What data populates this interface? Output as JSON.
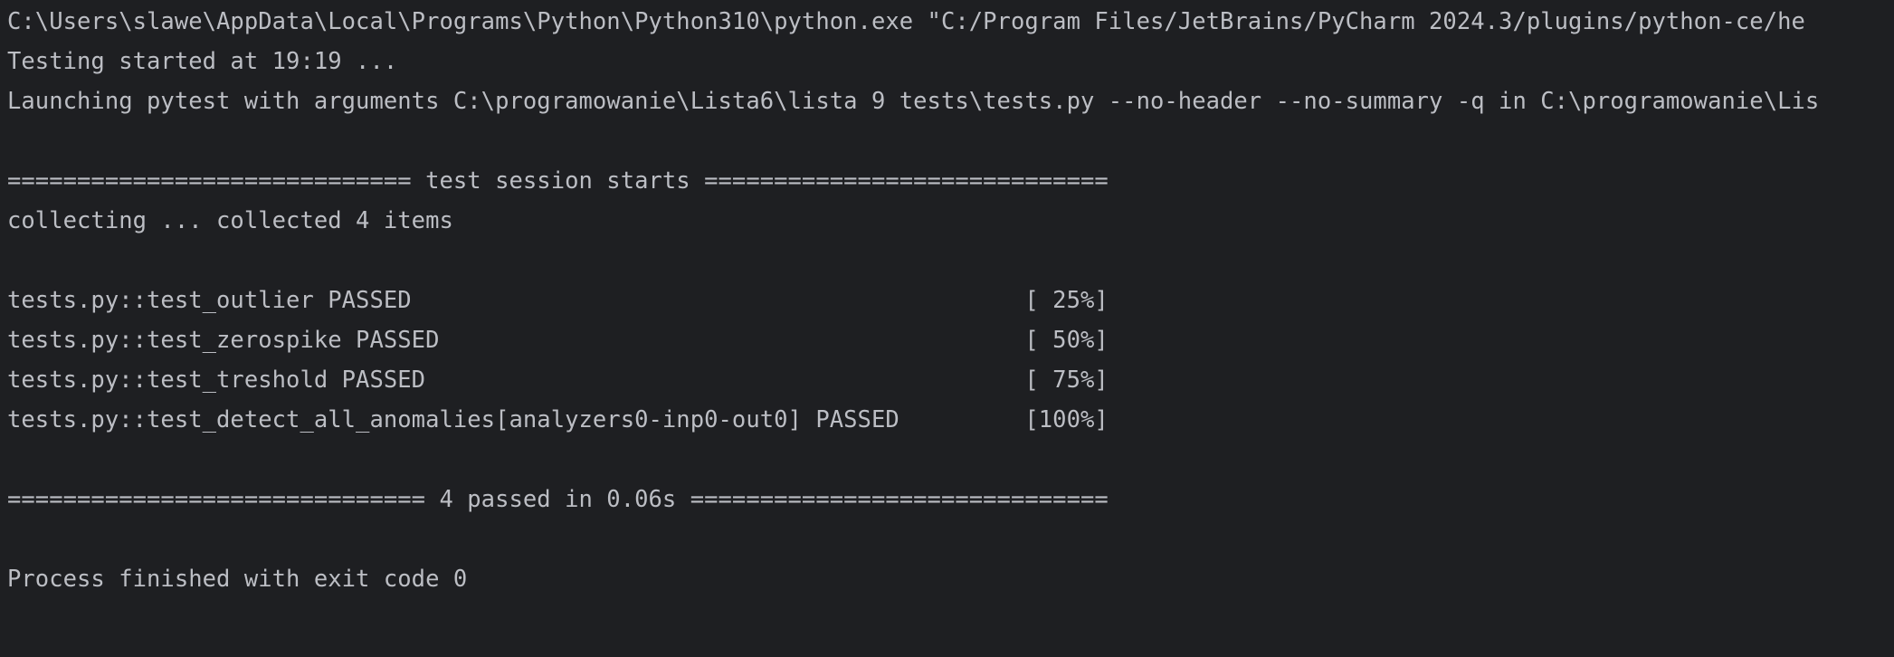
{
  "colors": {
    "background": "#1e1f22",
    "text": "#bcbec4"
  },
  "console": {
    "lines": [
      "C:\\Users\\slawe\\AppData\\Local\\Programs\\Python\\Python310\\python.exe \"C:/Program Files/JetBrains/PyCharm 2024.3/plugins/python-ce/he",
      "Testing started at 19:19 ...",
      "Launching pytest with arguments C:\\programowanie\\Lista6\\lista 9 tests\\tests.py --no-header --no-summary -q in C:\\programowanie\\Lis",
      "",
      "============================= test session starts =============================",
      "collecting ... collected 4 items",
      "",
      "tests.py::test_outlier PASSED                                            [ 25%]",
      "tests.py::test_zerospike PASSED                                          [ 50%]",
      "tests.py::test_treshold PASSED                                           [ 75%]",
      "tests.py::test_detect_all_anomalies[analyzers0-inp0-out0] PASSED         [100%]",
      "",
      "============================== 4 passed in 0.06s ==============================",
      "",
      "Process finished with exit code 0"
    ]
  }
}
